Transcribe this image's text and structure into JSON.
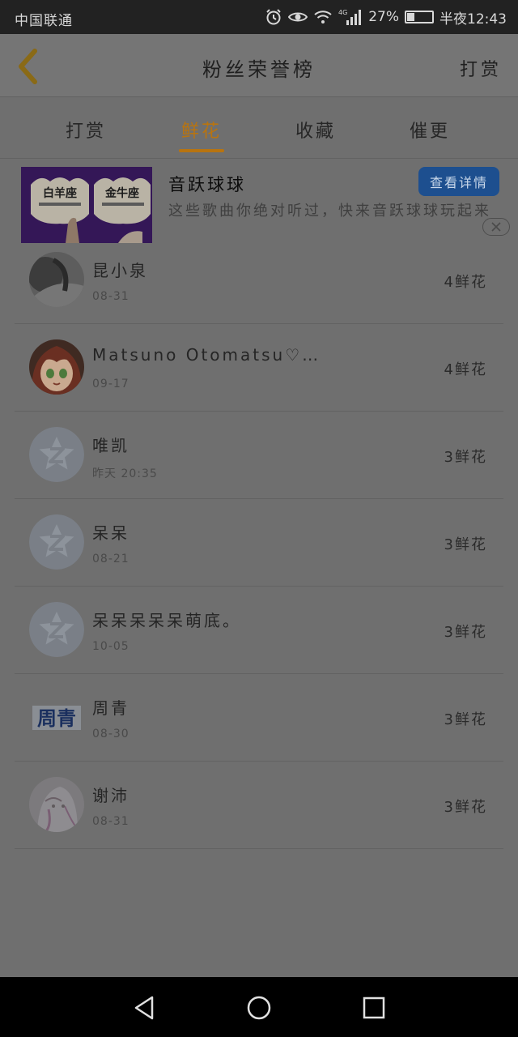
{
  "status_bar": {
    "carrier": "中国联通",
    "network": "4G",
    "battery_text": "27%",
    "battery_level": 0.27,
    "time": "半夜12:43",
    "icons": [
      "alarm-icon",
      "eye-icon",
      "wifi-icon",
      "signal-icon",
      "battery-icon"
    ]
  },
  "header": {
    "title": "粉丝荣誉榜",
    "right_action": "打赏",
    "back_icon": "chevron-left-icon"
  },
  "tabs": [
    {
      "label": "打赏",
      "active": false
    },
    {
      "label": "鲜花",
      "active": true
    },
    {
      "label": "收藏",
      "active": false
    },
    {
      "label": "催更",
      "active": false
    }
  ],
  "ad": {
    "image_texts": [
      "白羊座",
      "金牛座"
    ],
    "title": "音跃球球",
    "description": "这些歌曲你绝对听过，快来音跃球球玩起来",
    "button": "查看详情",
    "close_icon": "close-icon"
  },
  "fans": [
    {
      "name": "昆小泉",
      "date": "08-31",
      "count": "4鲜花",
      "avatar": "photo"
    },
    {
      "name": "Matsuno Otomatsu♡…",
      "date": "09-17",
      "count": "4鲜花",
      "avatar": "anime"
    },
    {
      "name": "唯凯",
      "date": "昨天 20:35",
      "count": "3鲜花",
      "avatar": "default"
    },
    {
      "name": "呆呆",
      "date": "08-21",
      "count": "3鲜花",
      "avatar": "default"
    },
    {
      "name": "呆呆呆呆呆萌底。",
      "date": "10-05",
      "count": "3鲜花",
      "avatar": "default"
    },
    {
      "name": "周青",
      "date": "08-30",
      "count": "3鲜花",
      "avatar": "text",
      "avatar_text": "周青"
    },
    {
      "name": "谢沛",
      "date": "08-31",
      "count": "3鲜花",
      "avatar": "drawing"
    }
  ],
  "colors": {
    "accent": "#b87410",
    "button": "#1d4f8f",
    "overlay_bg": "#6f6f6f"
  },
  "nav_bar": {
    "icons": [
      "back-triangle-icon",
      "home-circle-icon",
      "recents-square-icon"
    ]
  }
}
